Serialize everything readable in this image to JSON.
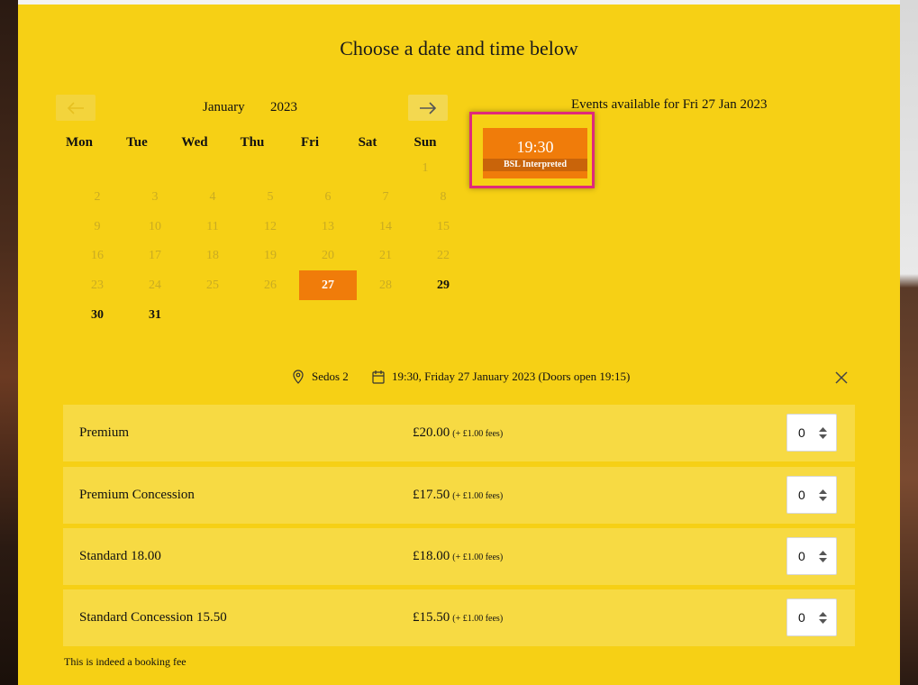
{
  "title": "Choose a date and time below",
  "calendar": {
    "month": "January",
    "year": "2023",
    "weekdays": [
      "Mon",
      "Tue",
      "Wed",
      "Thu",
      "Fri",
      "Sat",
      "Sun"
    ],
    "days": [
      "1",
      "2",
      "3",
      "4",
      "5",
      "6",
      "7",
      "8",
      "9",
      "10",
      "11",
      "12",
      "13",
      "14",
      "15",
      "16",
      "17",
      "18",
      "19",
      "20",
      "21",
      "22",
      "23",
      "24",
      "25",
      "26",
      "27",
      "28",
      "29",
      "30",
      "31"
    ],
    "selected_day": "27"
  },
  "events": {
    "title": "Events available for Fri 27 Jan 2023",
    "slot_time": "19:30",
    "slot_label": "BSL Interpreted"
  },
  "info": {
    "venue": "Sedos 2",
    "datetime": "19:30,  Friday 27 January 2023 (Doors open 19:15)"
  },
  "tickets": [
    {
      "name": "Premium",
      "price": "£20.00",
      "fee": "(+ £1.00 fees)",
      "qty": "0"
    },
    {
      "name": "Premium Concession",
      "price": "£17.50",
      "fee": "(+ £1.00 fees)",
      "qty": "0"
    },
    {
      "name": "Standard 18.00",
      "price": "£18.00",
      "fee": "(+ £1.00 fees)",
      "qty": "0"
    },
    {
      "name": "Standard Concession 15.50",
      "price": "£15.50",
      "fee": "(+ £1.00 fees)",
      "qty": "0"
    }
  ],
  "footnote": "This is indeed a booking fee",
  "colors": {
    "panel": "#f6d015",
    "accent": "#f07c0a",
    "highlight": "#e0297b"
  }
}
